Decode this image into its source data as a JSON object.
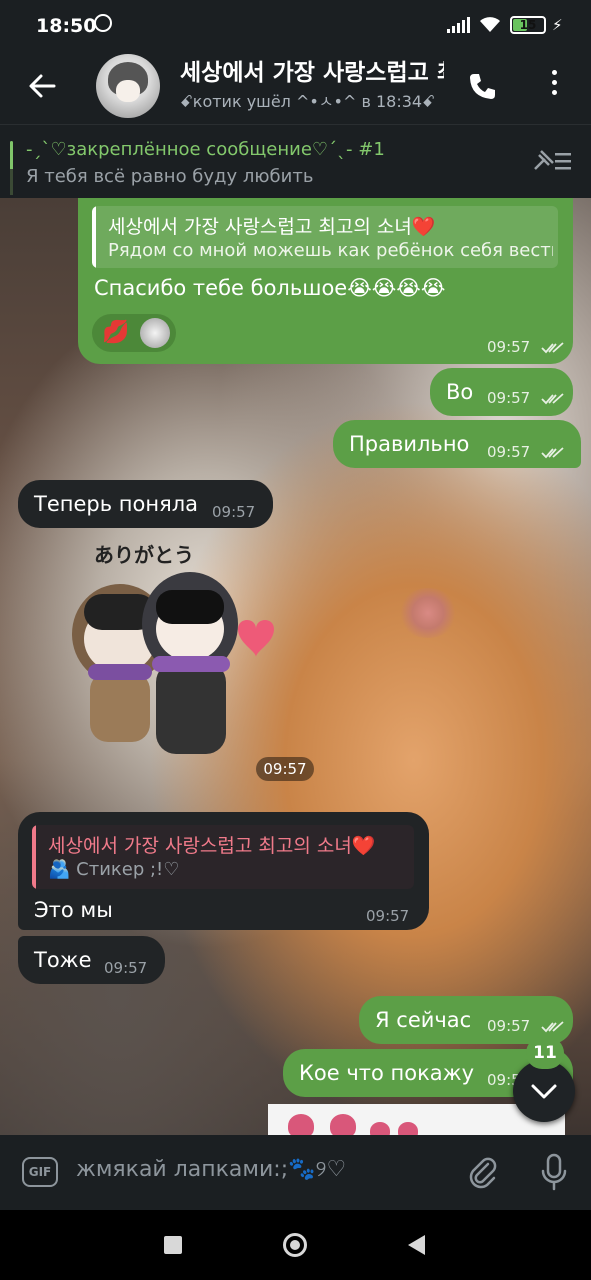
{
  "status": {
    "time": "18:50",
    "battery": "15"
  },
  "header": {
    "title": "세상에서 가장 사랑스럽고 최고의 소녀❤️",
    "subtitle": "ꗃкотик ушёл ^•ㅅ•^ в 18:34ꗃ"
  },
  "pinned": {
    "title": "-ˏˋ♡закреплённое сообщение♡ˊˎ- #1",
    "text": "Я тебя всё равно буду любить"
  },
  "messages": [
    {
      "direction": "out",
      "reply_name": "세상에서 가장 사랑스럽고 최고의 소녀❤️",
      "reply_text": "Рядом со мной можешь как ребёнок себя вести",
      "text": "Спасибо тебе большое😭😭😭😭",
      "reaction": "💋",
      "time": "09:57"
    },
    {
      "direction": "out",
      "text": "Во",
      "time": "09:57"
    },
    {
      "direction": "out",
      "text": "Правильно",
      "time": "09:57"
    },
    {
      "direction": "in",
      "text": "Теперь поняла",
      "time": "09:57"
    },
    {
      "direction": "in",
      "sticker_caption": "ありがとう",
      "time": "09:57"
    },
    {
      "direction": "in",
      "reply_name": "세상에서 가장 사랑스럽고 최고의 소녀❤️",
      "reply_text": "🫂 Стикер ;!♡",
      "text": "Это мы",
      "time": "09:57"
    },
    {
      "direction": "in",
      "text": "Тоже",
      "time": "09:57"
    },
    {
      "direction": "out",
      "text": "Я сейчас",
      "time": "09:57"
    },
    {
      "direction": "out",
      "text": "Кое что покажу",
      "time": "09:57"
    }
  ],
  "unread_badge": "11",
  "input": {
    "placeholder": "жмякай лапками:;🐾୨♡",
    "gif_label": "GIF"
  },
  "icons": [
    "alarm-icon",
    "signal-icon",
    "wifi-icon",
    "battery-icon",
    "charging-icon",
    "back-arrow-icon",
    "phone-icon",
    "more-vert-icon",
    "pinned-list-icon",
    "double-check-icon",
    "chevron-down-icon",
    "gif-icon",
    "attach-icon",
    "mic-icon"
  ],
  "colors": {
    "outgoing_bubble": "#5c9f47",
    "incoming_bubble": "#212426",
    "accent_green": "#83c86c",
    "reply_name_in": "#f07a8a"
  }
}
